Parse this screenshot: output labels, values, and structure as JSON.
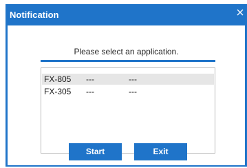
{
  "dialog": {
    "title": "Notification",
    "prompt": "Please select an application.",
    "accent_color": "#1f74c9",
    "close_icon": "close-icon"
  },
  "applications": [
    {
      "name": "FX-805",
      "col2": "---",
      "col3": "---",
      "selected": true
    },
    {
      "name": "FX-305",
      "col2": "---",
      "col3": "---",
      "selected": false
    }
  ],
  "buttons": {
    "start_label": "Start",
    "exit_label": "Exit"
  }
}
